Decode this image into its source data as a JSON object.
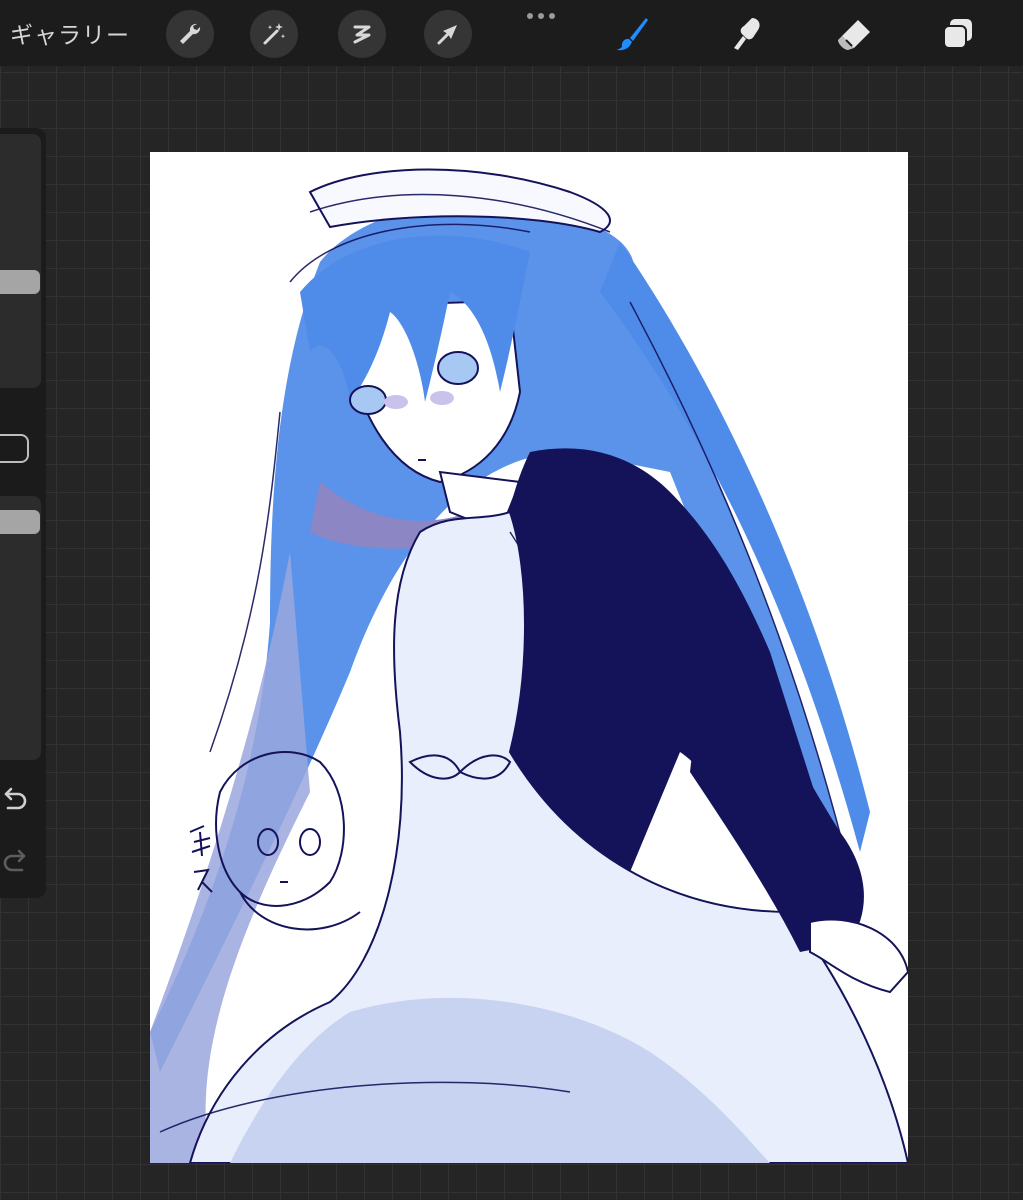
{
  "topbar": {
    "gallery_label": "ギャラリー",
    "actions": [
      {
        "name": "wrench-icon"
      },
      {
        "name": "magic-wand-icon"
      },
      {
        "name": "selection-icon"
      },
      {
        "name": "transform-arrow-icon"
      }
    ],
    "more_icon": "ellipsis-icon",
    "tools": [
      {
        "name": "brush-icon",
        "active": true,
        "color": "#1f8cff"
      },
      {
        "name": "smudge-icon",
        "active": false,
        "color": "#e8e8e8"
      },
      {
        "name": "eraser-icon",
        "active": false,
        "color": "#e8e8e8"
      },
      {
        "name": "layers-icon",
        "active": false,
        "color": "#e8e8e8"
      }
    ]
  },
  "sidebar": {
    "brush_size_level": 0.05,
    "opacity_level": 0.05,
    "undo_icon": "undo-icon",
    "redo_icon": "redo-icon"
  },
  "canvas": {
    "background": "#ffffff",
    "palette": {
      "hair": "#4f8be8",
      "hair_light": "#a8c8f4",
      "line": "#14135a",
      "shadow": "#c7d3f0",
      "blush": "#8c86c4"
    }
  }
}
